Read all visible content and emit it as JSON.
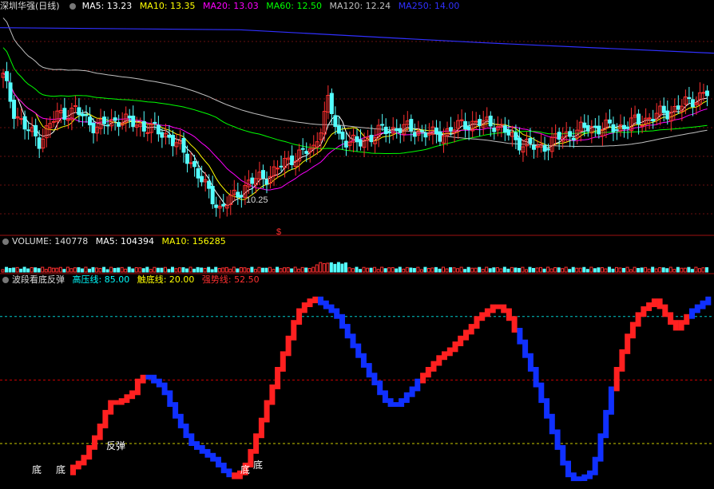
{
  "colors": {
    "background": "#000000",
    "up": "#ff3030",
    "down": "#54ffff",
    "ma5": "#ffffff",
    "ma10": "#ffff00",
    "ma20": "#ff00ff",
    "ma60": "#00ff00",
    "ma120": "#c0c0c0",
    "ma250": "#3030ff",
    "wave_up": "#ff2020",
    "wave_down": "#1030ff",
    "high_line": "#00ffff",
    "low_line": "#ffff00",
    "strong_line": "#ff0000"
  },
  "price_panel": {
    "title": "深圳华强(日线)",
    "ma5_label": "MA5: 13.23",
    "ma10_label": "MA10: 13.35",
    "ma20_label": "MA20: 13.03",
    "ma60_label": "MA60: 12.50",
    "ma120_label": "MA120: 12.24",
    "ma250_label": "MA250: 14.00",
    "low_marker": "10.25",
    "signal_marker": "$"
  },
  "volume_panel": {
    "volume_label": "VOLUME: 140778",
    "ma5_label": "MA5: 104394",
    "ma10_label": "MA10: 156285"
  },
  "indicator_panel": {
    "title": "波段看底反弹",
    "high_label": "高压线: 85.00",
    "touch_label": "触底线: 20.00",
    "strong_label": "强势线: 52.50",
    "rebound_text": "反弹",
    "bottom_text": "底"
  },
  "chart_data": [
    {
      "type": "candlestick",
      "title": "深圳华强(日线)",
      "ylim": [
        9.9,
        15.0
      ],
      "grid": true,
      "low_annotation": 10.25,
      "series_names": [
        "MA5",
        "MA10",
        "MA20",
        "MA60",
        "MA120",
        "MA250"
      ],
      "latest_ma_values": {
        "MA5": 13.23,
        "MA10": 13.35,
        "MA20": 13.03,
        "MA60": 12.5,
        "MA120": 12.24,
        "MA250": 14.0
      }
    },
    {
      "type": "bar",
      "title": "VOLUME",
      "latest_volume": 140778,
      "latest_ma": {
        "MA5": 104394,
        "MA10": 156285
      }
    },
    {
      "type": "bar",
      "title": "波段看底反弹",
      "ylim": [
        0,
        100
      ],
      "reference_lines": [
        {
          "name": "高压线",
          "value": 85.0
        },
        {
          "name": "强势线",
          "value": 52.5
        },
        {
          "name": "触底线",
          "value": 20.0
        }
      ],
      "oscillator_values": [
        8,
        10,
        13,
        18,
        23,
        29,
        36,
        41,
        41,
        42,
        44,
        46,
        52,
        54,
        54,
        52,
        50,
        46,
        40,
        34,
        29,
        24,
        20,
        18,
        16,
        14,
        12,
        9,
        6,
        4,
        3,
        5,
        9,
        16,
        24,
        32,
        41,
        49,
        58,
        66,
        74,
        82,
        88,
        91,
        93,
        94,
        92,
        90,
        88,
        85,
        80,
        75,
        70,
        65,
        60,
        55,
        51,
        46,
        42,
        40,
        40,
        42,
        45,
        48,
        52,
        55,
        58,
        61,
        64,
        66,
        68,
        71,
        74,
        77,
        80,
        84,
        86,
        88,
        90,
        90,
        88,
        84,
        78,
        72,
        65,
        58,
        50,
        42,
        34,
        26,
        18,
        10,
        4,
        2,
        2,
        3,
        5,
        12,
        24,
        36,
        48,
        58,
        67,
        75,
        81,
        86,
        89,
        91,
        93,
        90,
        86,
        82,
        79,
        82,
        85,
        88,
        90,
        92,
        94
      ],
      "oscillator_directions": "UUUUUUUUUUUUUUDDDDDDDDDDDDDDDDUUUUUUUUUUUUUUUUDDDDDDDDDDDDDDDDDDDUUUUUUUUUUUUUUUUUUDDDDDDDDDDDDDDDDDDUUUUUUUUUUUUUUDDDDUUUUUU"
    }
  ]
}
